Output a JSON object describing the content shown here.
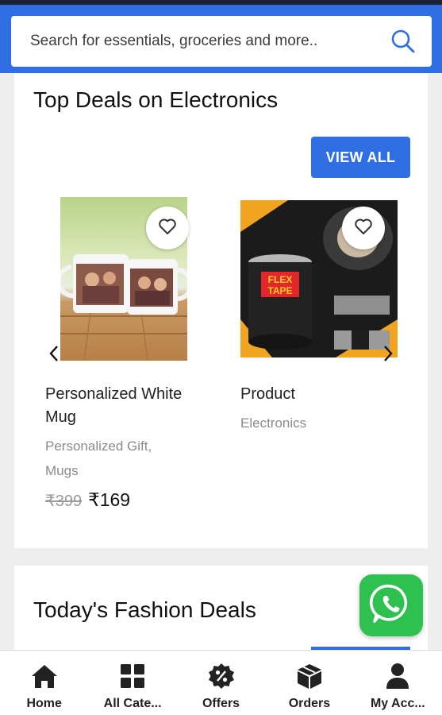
{
  "search": {
    "placeholder": "Search for essentials, groceries and more.."
  },
  "electronics": {
    "title": "Top Deals on Electronics",
    "view_all_label": "VIEW ALL",
    "products": [
      {
        "name": "Personalized White Mug",
        "category": "Personalized Gift, Mugs",
        "old_price": "₹399",
        "price": "₹169"
      },
      {
        "name": "Product",
        "category": "Electronics"
      }
    ]
  },
  "fashion": {
    "title": "Today's Fashion Deals"
  },
  "bottom_nav": [
    {
      "label": "Home",
      "icon": "home-icon"
    },
    {
      "label": "All Cate...",
      "icon": "grid-icon"
    },
    {
      "label": "Offers",
      "icon": "offer-badge-icon"
    },
    {
      "label": "Orders",
      "icon": "box-icon"
    },
    {
      "label": "My Acc...",
      "icon": "user-icon"
    }
  ],
  "colors": {
    "accent": "#2f6fe3",
    "whatsapp": "#2fc14f"
  }
}
